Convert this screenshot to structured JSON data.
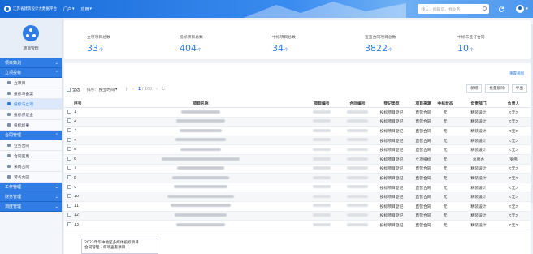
{
  "topbar": {
    "title": "江苏省建筑设计大数据平台",
    "nav": [
      {
        "label": "门户"
      },
      {
        "label": "应用"
      }
    ],
    "search_placeholder": "找人、找知识、找业务"
  },
  "sidebar": {
    "app_label": "项目管理",
    "groups": [
      {
        "label": "项目策划",
        "items": []
      },
      {
        "label": "立项投标",
        "items": [
          {
            "label": "立项目",
            "active": false
          },
          {
            "label": "投标与备案",
            "active": false
          },
          {
            "label": "投标与立项",
            "active": true
          },
          {
            "label": "投标保证金",
            "active": false
          },
          {
            "label": "投标结果",
            "active": false
          }
        ]
      },
      {
        "label": "合同管理",
        "items": [
          {
            "label": "业务合同",
            "active": false
          },
          {
            "label": "合同变更",
            "active": false
          },
          {
            "label": "采购合同",
            "active": false
          },
          {
            "label": "劳务合同",
            "active": false
          }
        ]
      },
      {
        "label": "工作管理",
        "items": []
      },
      {
        "label": "财务管理",
        "items": []
      },
      {
        "label": "调度管理",
        "items": []
      }
    ]
  },
  "stats": [
    {
      "label": "立项项目总数",
      "value": "33",
      "unit": "个"
    },
    {
      "label": "投标项目总数",
      "value": "404",
      "unit": "个"
    },
    {
      "label": "中标项目总数",
      "value": "34",
      "unit": "个"
    },
    {
      "label": "签签合同项目总数",
      "value": "3822",
      "unit": "个"
    },
    {
      "label": "中标未签订合同",
      "value": "10",
      "unit": "个"
    }
  ],
  "panel": {
    "reset_link": "重置视图",
    "select_all": "全选",
    "sort_label": "排序:",
    "sort_value": "按立时间",
    "page_current": "1",
    "page_total": "/ 200",
    "buttons": [
      "新增",
      "批量删除",
      "导出"
    ]
  },
  "table": {
    "headers": [
      "序号",
      "项目名称",
      "项目编号",
      "合同编号",
      "登记类型",
      "项目来源",
      "中标状态",
      "负责部门",
      "负责人"
    ],
    "rows": [
      {
        "idx": "1",
        "type": "投标项目登记",
        "src": "直营合同",
        "status": "无",
        "dept": "精装设计",
        "person": "<无>"
      },
      {
        "idx": "2",
        "type": "投标项目登记",
        "src": "直营合同",
        "status": "无",
        "dept": "精装设计",
        "person": "<无>"
      },
      {
        "idx": "3",
        "type": "投标项目登记",
        "src": "直营合同",
        "status": "无",
        "dept": "精装设计",
        "person": "<无>"
      },
      {
        "idx": "4",
        "type": "投标项目登记",
        "src": "直营合同",
        "status": "无",
        "dept": "精装设计",
        "person": "<无>"
      },
      {
        "idx": "5",
        "type": "投标项目登记",
        "src": "直营合同",
        "status": "无",
        "dept": "精装设计",
        "person": "<无>"
      },
      {
        "idx": "6",
        "type": "投标项目登记",
        "src": "立项投标",
        "status": "无",
        "dept": "总师办",
        "person": "罗伟"
      },
      {
        "idx": "7",
        "type": "投标项目登记",
        "src": "直营合同",
        "status": "无",
        "dept": "精装设计",
        "person": "<无>"
      },
      {
        "idx": "8",
        "type": "投标项目登记",
        "src": "直营合同",
        "status": "无",
        "dept": "精装设计",
        "person": "<无>"
      },
      {
        "idx": "9",
        "type": "投标项目登记",
        "src": "直营合同",
        "status": "无",
        "dept": "精装设计",
        "person": "<无>"
      },
      {
        "idx": "10",
        "type": "投标项目登记",
        "src": "直营合同",
        "status": "无",
        "dept": "精装设计",
        "person": "<无>"
      },
      {
        "idx": "11",
        "type": "投标项目登记",
        "src": "直营合同",
        "status": "无",
        "dept": "精装设计",
        "person": "<无>"
      },
      {
        "idx": "12",
        "type": "投标项目登记",
        "src": "直营合同",
        "status": "无",
        "dept": "精装设计",
        "person": "<无>"
      },
      {
        "idx": "13",
        "type": "投标项目登记",
        "src": "直营合同",
        "status": "无",
        "dept": "精装设计",
        "person": "<无>"
      }
    ]
  },
  "tooltip": {
    "line1": "2023年华中地区多媒体投标项目",
    "line2": "合同管理 · 单项查看项目"
  },
  "colors": {
    "primary": "#2f7de4",
    "topbar": "#1769d6"
  }
}
